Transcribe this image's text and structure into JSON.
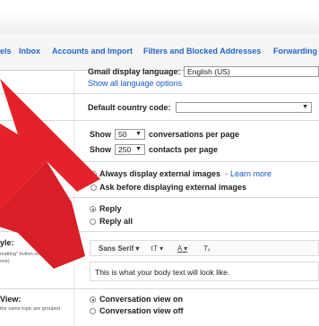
{
  "nav": {
    "tabs": [
      "els",
      "Inbox",
      "Accounts and Import",
      "Filters and Blocked Addresses",
      "Forwarding"
    ]
  },
  "settings": {
    "language": {
      "label": "Gmail display language:",
      "value": "English (US)",
      "link": "Show all language options"
    },
    "country": {
      "label": "Default country code:",
      "value": ""
    },
    "page_size": {
      "show_label": "Show",
      "conversations_value": "50",
      "conversations_text": "conversations per page",
      "contacts_value": "250",
      "contacts_text": "contacts per page"
    },
    "images": {
      "option1": "Always display external images",
      "option1_link": "Learn more",
      "option2": "Ask before displaying external images"
    },
    "reply": {
      "label_fragment": "av",
      "option1": "Reply",
      "option2": "Reply all"
    },
    "style": {
      "label_fragment": "yle:",
      "hint1": "matting\" button on",
      "hint2": "ove)",
      "font": "Sans Serif",
      "size_icon": "τT",
      "color_icon": "A",
      "clear_icon": "Tₓ",
      "preview": "This is what your body text will look like."
    },
    "conversation": {
      "label_fragment": "View:",
      "hint": "the same topic are grouped",
      "option1": "Conversation view on",
      "option2": "Conversation view off"
    }
  },
  "colors": {
    "arrow": "#e5222b",
    "link": "#1155cc",
    "nav_link": "#2266cc"
  }
}
